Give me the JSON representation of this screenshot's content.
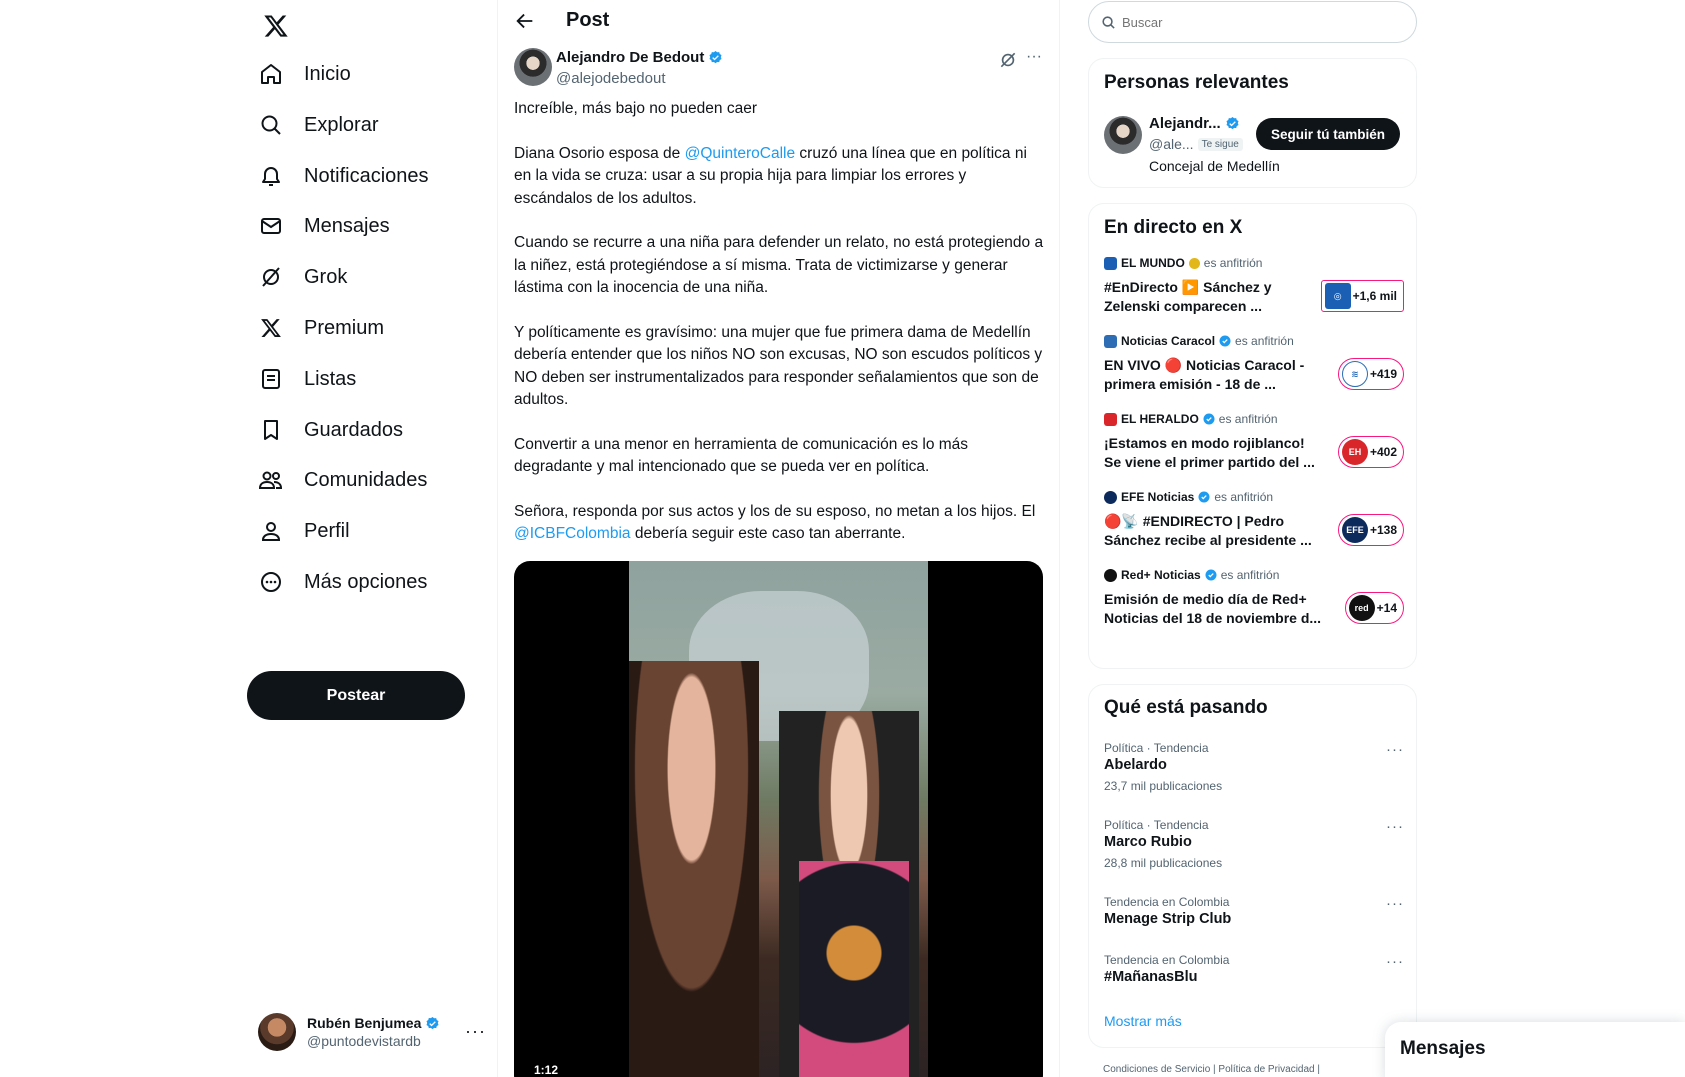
{
  "nav": {
    "items": [
      {
        "label": "Inicio",
        "icon": "home-icon"
      },
      {
        "label": "Explorar",
        "icon": "search-icon"
      },
      {
        "label": "Notificaciones",
        "icon": "bell-icon"
      },
      {
        "label": "Mensajes",
        "icon": "mail-icon"
      },
      {
        "label": "Grok",
        "icon": "grok-icon"
      },
      {
        "label": "Premium",
        "icon": "x-logo-icon"
      },
      {
        "label": "Listas",
        "icon": "list-icon"
      },
      {
        "label": "Guardados",
        "icon": "bookmark-icon"
      },
      {
        "label": "Comunidades",
        "icon": "communities-icon"
      },
      {
        "label": "Perfil",
        "icon": "person-icon"
      },
      {
        "label": "Más opciones",
        "icon": "more-circle-icon"
      }
    ],
    "post_button": "Postear",
    "account": {
      "name": "Rubén Benjumea",
      "handle": "@puntodevistardb"
    }
  },
  "main": {
    "header_title": "Post",
    "tweet": {
      "author_name": "Alejandro De Bedout",
      "author_handle": "@alejodebedout",
      "p1": "Increíble, más bajo no pueden caer",
      "p2_a": "Diana Osorio esposa de ",
      "p2_mention": "@QuinteroCalle",
      "p2_b": " cruzó una línea que en política ni en la vida se cruza: usar a su propia hija para limpiar los errores y escándalos de los adultos.",
      "p3": "Cuando se recurre a una niña para defender un relato, no está protegiendo a la niñez, está protegiéndose a sí misma. Trata de victimizarse y generar lástima con la inocencia de una niña.",
      "p4": "Y políticamente es gravísimo: una mujer que fue primera dama de Medellín debería entender que los niños NO son excusas, NO son escudos políticos y NO deben ser instrumentalizados para responder señalamientos que son de adultos.",
      "p5": "Convertir a una menor en herramienta de comunicación es lo más degradante y mal intencionado que se pueda ver en política.",
      "p6_a": "Señora, responda por sus actos y los de su esposo, no metan a los hijos. El ",
      "p6_mention": "@ICBFColombia",
      "p6_b": " debería seguir este caso tan aberrante.",
      "video_time": "1:12"
    }
  },
  "sidebar": {
    "search_placeholder": "Buscar",
    "relevant": {
      "title": "Personas relevantes",
      "name": "Alejandr...",
      "handle": "@ale...",
      "follows_you": "Te sigue",
      "bio": "Concejal de Medellín",
      "follow_button": "Seguir tú también"
    },
    "live": {
      "title": "En directo en X",
      "items": [
        {
          "host": "EL MUNDO",
          "role": "es anfitrión",
          "title": "#EnDirecto ▶️ Sánchez y Zelenski comparecen ...",
          "count": "+1,6 mil",
          "color": "#1a5fb4"
        },
        {
          "host": "Noticias Caracol",
          "role": "es anfitrión",
          "title": "EN VIVO 🔴 Noticias Caracol - primera emisión - 18 de ...",
          "count": "+419",
          "color": "#2e6db4"
        },
        {
          "host": "EL HERALDO",
          "role": "es anfitrión",
          "title": "¡Estamos en modo rojiblanco! Se viene el primer partido del ...",
          "count": "+402",
          "color": "#d9262b"
        },
        {
          "host": "EFE Noticias",
          "role": "es anfitrión",
          "title": "🔴📡 #ENDIRECTO | Pedro Sánchez recibe al presidente ...",
          "count": "+138",
          "color": "#0d2a5c"
        },
        {
          "host": "Red+ Noticias",
          "role": "es anfitrión",
          "title": "Emisión de medio día de Red+ Noticias del 18 de noviembre d...",
          "count": "+14",
          "color": "#111111"
        }
      ]
    },
    "trends": {
      "title": "Qué está pasando",
      "items": [
        {
          "context": "Política · Tendencia",
          "name": "Abelardo",
          "count": "23,7 mil publicaciones"
        },
        {
          "context": "Política · Tendencia",
          "name": "Marco Rubio",
          "count": "28,8 mil publicaciones"
        },
        {
          "context": "Tendencia en Colombia",
          "name": "Menage Strip Club",
          "count": ""
        },
        {
          "context": "Tendencia en Colombia",
          "name": "#MañanasBlu",
          "count": ""
        }
      ],
      "show_more": "Mostrar más"
    },
    "footer": "Condiciones de Servicio  |  Política de Privacidad  |"
  },
  "messages_drawer": {
    "title": "Mensajes"
  },
  "colors": {
    "accent": "#1d9bf0",
    "live_ring": "#f91880",
    "text": "#0f1419",
    "muted": "#536471"
  }
}
